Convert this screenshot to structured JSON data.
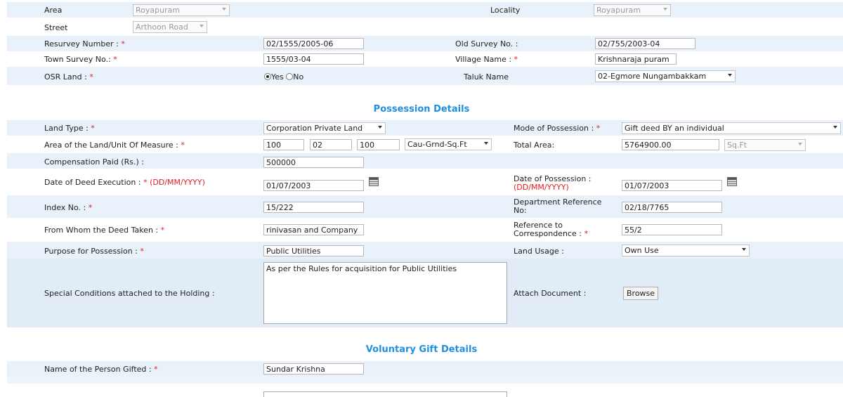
{
  "top": {
    "area_label": "Area",
    "area_value": "Royapuram",
    "locality_label": "Locality",
    "locality_value": "Royapuram",
    "street_label": "Street",
    "street_value": "Arthoon Road",
    "resurvey_label": "Resurvey Number :",
    "resurvey_value": "02/1555/2005-06",
    "old_survey_label": "Old Survey No. :",
    "old_survey_value": "02/755/2003-04",
    "town_survey_label": "Town Survey No.:",
    "town_survey_value": "1555/03-04",
    "village_label": "Village Name :",
    "village_value": "Krishnaraja puram",
    "osr_label": "OSR Land :",
    "osr_yes": "Yes",
    "osr_no": "No",
    "taluk_label": "Taluk Name",
    "taluk_value": "02-Egmore Nungambakkam"
  },
  "possession": {
    "title": "Possession Details",
    "land_type_label": "Land Type :",
    "land_type_value": "Corporation Private Land",
    "mode_label": "Mode of Possession :",
    "mode_value": "Gift deed BY an individual",
    "area_label": "Area of the Land/Unit Of Measure :",
    "area_v1": "100",
    "area_v2": "02",
    "area_v3": "100",
    "area_unit": "Cau-Grnd-Sq.Ft",
    "total_area_label": "Total Area:",
    "total_area_value": "5764900.00",
    "total_area_unit": "Sq.Ft",
    "compensation_label": "Compensation Paid (Rs.) :",
    "compensation_value": "500000",
    "deed_exec_label": "Date of Deed Execution :",
    "deed_exec_format": "(DD/MM/YYYY)",
    "deed_exec_value": "01/07/2003",
    "possession_date_label": "Date of Possession :",
    "possession_date_format": "(DD/MM/YYYY)",
    "possession_date_value": "01/07/2003",
    "index_label": "Index No. :",
    "index_value": "15/222",
    "dept_ref_label_1": "Department Reference",
    "dept_ref_label_2": "No:",
    "dept_ref_value": "02/18/7765",
    "from_whom_label": "From Whom the Deed Taken :",
    "from_whom_value": "rinivasan and Company",
    "ref_corr_label_1": "Reference to",
    "ref_corr_label_2": "Correspondence :",
    "ref_corr_value": "55/2",
    "purpose_label": "Purpose for Possession :",
    "purpose_value": "Public Utilities",
    "land_usage_label": "Land Usage :",
    "land_usage_value": "Own Use",
    "special_label": "Special Conditions attached to the Holding :",
    "special_value": "As per the Rules for acquisition for Public Utilities",
    "attach_label": "Attach Document :",
    "browse_label": "Browse"
  },
  "gift": {
    "title": "Voluntary Gift Details",
    "person_label": "Name of the Person Gifted :",
    "person_value": "Sundar Krishna"
  },
  "required_mark": "*"
}
